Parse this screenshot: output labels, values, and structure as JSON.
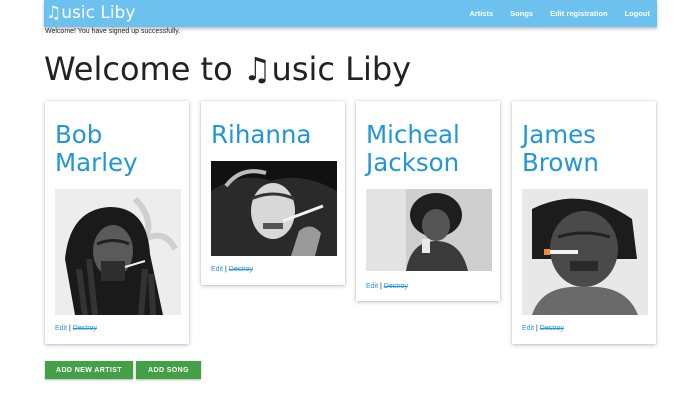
{
  "nav": {
    "brand": "usic Liby",
    "links": [
      "Artists",
      "Songs",
      "Edit registration",
      "Logout"
    ]
  },
  "flash": "Welcome! You have signed up successfully.",
  "page_title": "usic Liby",
  "page_title_prefix": "Welcome to",
  "artists": [
    {
      "name": "Bob Marley",
      "edit": "Edit",
      "sep": "|",
      "destroy": "Destroy"
    },
    {
      "name": "Rihanna",
      "edit": "Edit",
      "sep": "|",
      "destroy": "Destroy"
    },
    {
      "name": "Micheal Jackson",
      "edit": "Edit",
      "sep": "|",
      "destroy": "Destroy"
    },
    {
      "name": "James Brown",
      "edit": "Edit",
      "sep": "|",
      "destroy": "Destroy"
    }
  ],
  "buttons": {
    "add_artist": "ADD NEW ARTIST",
    "add_song": "ADD SONG"
  },
  "colors": {
    "navbar": "#6cc1ef",
    "link": "#2196d9",
    "button": "#43a047"
  },
  "icons": {
    "brand": "music-note-icon",
    "title": "music-note-icon"
  }
}
